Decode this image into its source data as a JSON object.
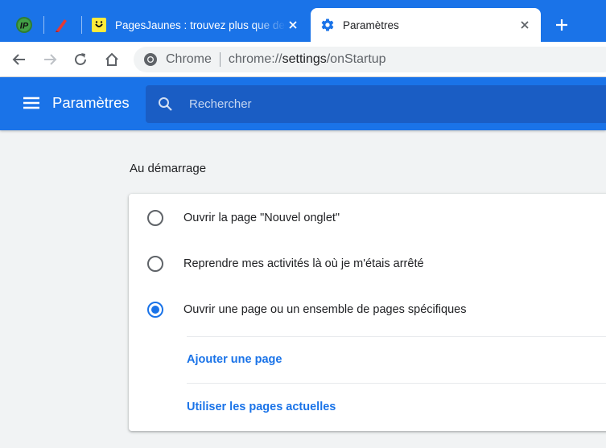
{
  "tabs": {
    "pinned": [
      {
        "icon": "ip-favicon-icon",
        "label": "IP"
      },
      {
        "icon": "red-pen-favicon-icon"
      }
    ],
    "inactive_tab": {
      "title": "PagesJaunes : trouvez plus que des",
      "icon": "pagesjaunes-favicon-icon"
    },
    "active_tab": {
      "title": "Paramètres",
      "icon": "gear-icon"
    },
    "new_tab_icon": "plus-icon"
  },
  "toolbar": {
    "back_icon": "back-arrow-icon",
    "forward_icon": "forward-arrow-icon",
    "reload_icon": "reload-icon",
    "home_icon": "home-icon",
    "omnibox": {
      "scheme_label": "Chrome",
      "url_prefix": "chrome://",
      "url_host": "settings",
      "url_path": "/onStartup"
    }
  },
  "header": {
    "title": "Paramètres",
    "search_placeholder": "Rechercher"
  },
  "startup": {
    "section_title": "Au démarrage",
    "options": [
      {
        "label": "Ouvrir la page \"Nouvel onglet\"",
        "checked": false
      },
      {
        "label": "Reprendre mes activités là où je m'étais arrêté",
        "checked": false
      },
      {
        "label": "Ouvrir une page ou un ensemble de pages spécifiques",
        "checked": true
      }
    ],
    "add_page_label": "Ajouter une page",
    "use_current_label": "Utiliser les pages actuelles"
  },
  "colors": {
    "accent": "#1a73e8",
    "header_search_bg": "#1a5dc4",
    "page_bg": "#f1f3f4"
  }
}
